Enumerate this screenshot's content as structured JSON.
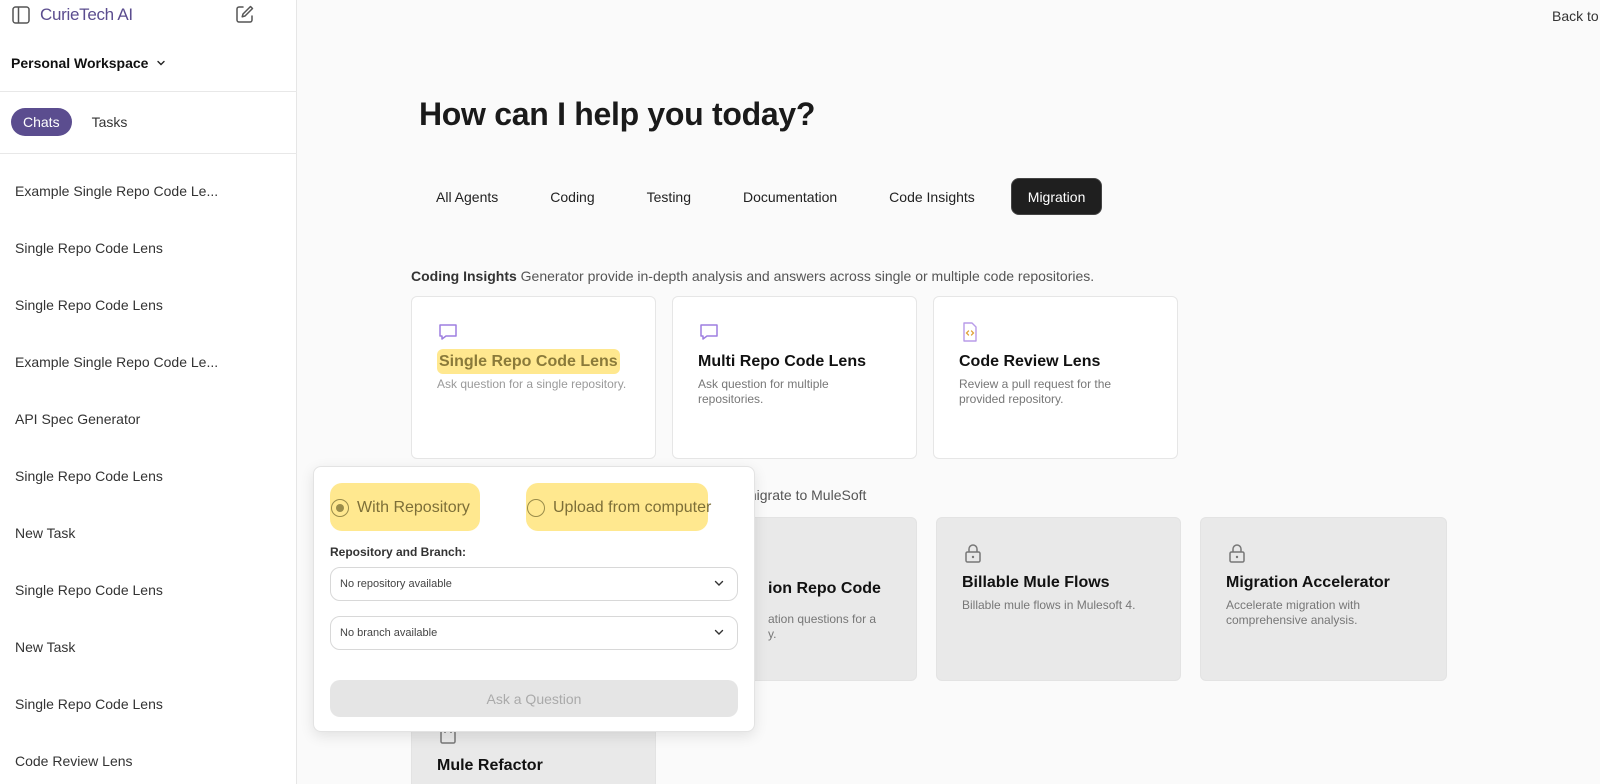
{
  "sidebar": {
    "brand": "CurieTech AI",
    "workspace": "Personal Workspace",
    "pills": {
      "chats": "Chats",
      "tasks": "Tasks"
    },
    "items": [
      "Example Single Repo Code Le...",
      "Single Repo Code Lens",
      "Single Repo Code Lens",
      "Example Single Repo Code Le...",
      "API Spec Generator",
      "Single Repo Code Lens",
      "New Task",
      "Single Repo Code Lens",
      "New Task",
      "Single Repo Code Lens",
      "Code Review Lens"
    ]
  },
  "header": {
    "back": "Back to"
  },
  "main": {
    "heading": "How can I help you today?",
    "tabs": [
      "All Agents",
      "Coding",
      "Testing",
      "Documentation",
      "Code Insights",
      "Migration"
    ],
    "active_tab": "Migration",
    "section1": {
      "bold": "Coding Insights",
      "text": " Generator provide in-depth analysis and answers across single or multiple code repositories."
    },
    "cards1": [
      {
        "title": "Single Repo Code Lens",
        "desc": "Ask question for a single repository.",
        "icon": "chat-bubble-icon"
      },
      {
        "title": "Multi Repo Code Lens",
        "desc": "Ask question for multiple repositories.",
        "icon": "chat-bubble-icon"
      },
      {
        "title": "Code Review Lens",
        "desc": "Review a pull request for the provided repository.",
        "icon": "code-file-icon"
      }
    ],
    "section2_text": "migrate to MuleSoft",
    "cards2": [
      {
        "title": "ion Repo Code",
        "desc": "ation questions for a",
        "desc2": "y."
      },
      {
        "title": "Billable Mule Flows",
        "desc": "Billable mule flows in Mulesoft 4.",
        "icon": "lock-icon"
      },
      {
        "title": "Migration Accelerator",
        "desc": "Accelerate migration with comprehensive analysis.",
        "icon": "lock-icon"
      }
    ],
    "card3": {
      "title": "Mule Refactor",
      "icon": "calendar-icon"
    }
  },
  "popup": {
    "radio1": "With Repository",
    "radio2": "Upload from computer",
    "field_label": "Repository and Branch:",
    "repo_select": "No repository available",
    "branch_select": "No branch available",
    "ask_button": "Ask a Question"
  },
  "colors": {
    "brand": "#5b4d8f",
    "highlight": "#ffd633",
    "tab_active": "#1f1f1f"
  }
}
